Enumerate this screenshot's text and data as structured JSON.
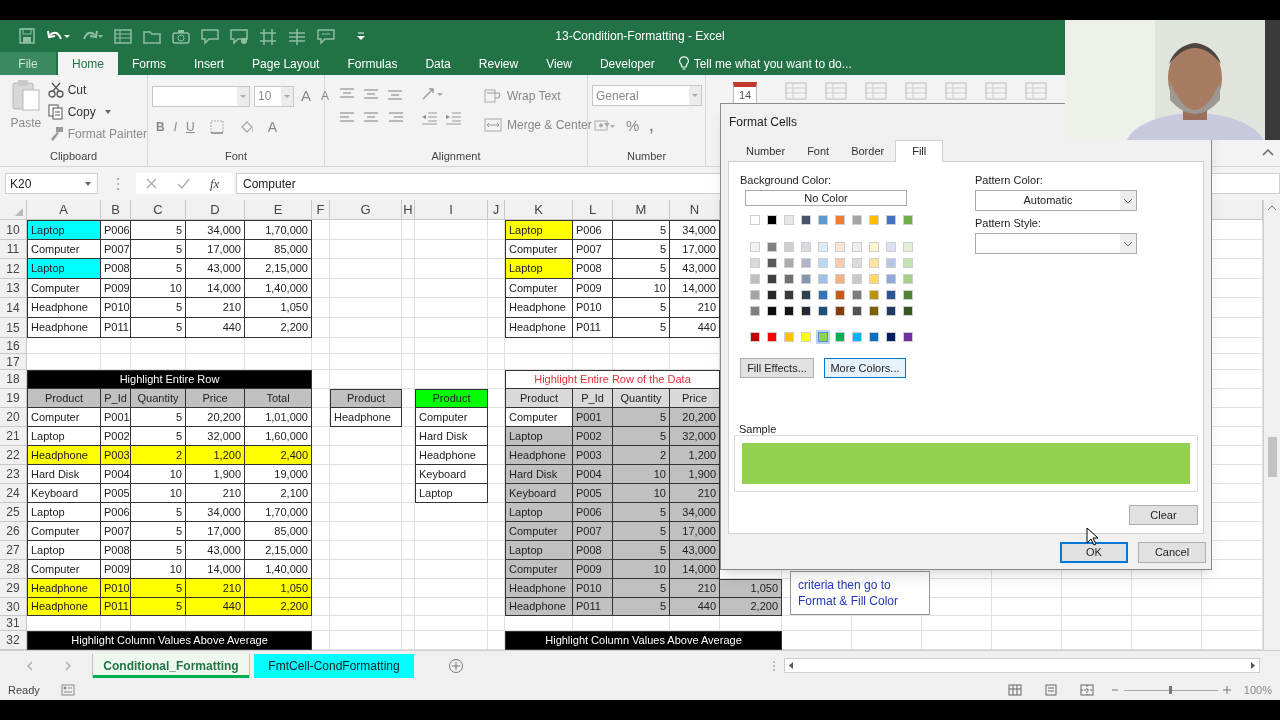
{
  "window": {
    "title": "13-Condition-Formatting - Excel"
  },
  "ribbon": {
    "tabs": [
      {
        "label": "File",
        "kind": "backstage",
        "selected": false
      },
      {
        "label": "Home",
        "kind": "tab",
        "selected": true
      },
      {
        "label": "Forms",
        "kind": "tab",
        "selected": false
      },
      {
        "label": "Insert",
        "kind": "tab",
        "selected": false
      },
      {
        "label": "Page Layout",
        "kind": "tab",
        "selected": false
      },
      {
        "label": "Formulas",
        "kind": "tab",
        "selected": false
      },
      {
        "label": "Data",
        "kind": "tab",
        "selected": false
      },
      {
        "label": "Review",
        "kind": "tab",
        "selected": false
      },
      {
        "label": "View",
        "kind": "tab",
        "selected": false
      },
      {
        "label": "Developer",
        "kind": "tab",
        "selected": false
      }
    ],
    "tell_me": "Tell me what you want to do...",
    "clipboard": {
      "paste": "Paste",
      "cut": "Cut",
      "copy": "Copy",
      "format_painter": "Format Painter",
      "label": "Clipboard"
    },
    "font": {
      "size": "10",
      "grow": "A",
      "shrink": "A",
      "bold": "B",
      "italic": "I",
      "underline": "U",
      "font_color": "A",
      "label": "Font"
    },
    "alignment": {
      "wrap_text": "Wrap Text",
      "merge_center": "Merge & Center",
      "label": "Alignment"
    },
    "number": {
      "format": "General",
      "percent": "%",
      "comma": ",",
      "label": "Number"
    },
    "calendar_day": "14"
  },
  "formula_bar": {
    "name_box": "K20",
    "fx": "fx",
    "formula": "Computer"
  },
  "grid": {
    "columns": [
      "A",
      "B",
      "C",
      "D",
      "E",
      "F",
      "G",
      "H",
      "I",
      "J",
      "K",
      "L",
      "M",
      "N"
    ],
    "rows": [
      {
        "number": "10",
        "cells": [
          {
            "text": "Laptop",
            "color": "#00ffff"
          },
          {
            "text": "P006"
          },
          {
            "text": "5"
          },
          {
            "text": "34,000"
          },
          {
            "text": "1,70,000"
          },
          {},
          {},
          {},
          {},
          {},
          {
            "text": "Laptop",
            "color": "#ffff00"
          },
          {
            "text": "P006"
          },
          {
            "text": "5"
          },
          {
            "text": "34,000"
          }
        ]
      },
      {
        "number": "11",
        "cells": [
          {
            "text": "Computer"
          },
          {
            "text": "P007"
          },
          {
            "text": "5"
          },
          {
            "text": "17,000"
          },
          {
            "text": "85,000"
          },
          {},
          {},
          {},
          {},
          {},
          {
            "text": "Computer"
          },
          {
            "text": "P007"
          },
          {
            "text": "5"
          },
          {
            "text": "17,000"
          }
        ]
      },
      {
        "number": "12",
        "cells": [
          {
            "text": "Laptop",
            "color": "#00ffff"
          },
          {
            "text": "P008"
          },
          {
            "text": "5"
          },
          {
            "text": "43,000"
          },
          {
            "text": "2,15,000"
          },
          {},
          {},
          {},
          {},
          {},
          {
            "text": "Laptop",
            "color": "#ffff00"
          },
          {
            "text": "P008"
          },
          {
            "text": "5"
          },
          {
            "text": "43,000"
          }
        ]
      },
      {
        "number": "13",
        "cells": [
          {
            "text": "Computer"
          },
          {
            "text": "P009"
          },
          {
            "text": "10"
          },
          {
            "text": "14,000"
          },
          {
            "text": "1,40,000"
          },
          {},
          {},
          {},
          {},
          {},
          {
            "text": "Computer"
          },
          {
            "text": "P009"
          },
          {
            "text": "10"
          },
          {
            "text": "14,000"
          }
        ]
      },
      {
        "number": "14",
        "cells": [
          {
            "text": "Headphone"
          },
          {
            "text": "P010"
          },
          {
            "text": "5"
          },
          {
            "text": "210"
          },
          {
            "text": "1,050"
          },
          {},
          {},
          {},
          {},
          {},
          {
            "text": "Headphone"
          },
          {
            "text": "P010"
          },
          {
            "text": "5"
          },
          {
            "text": "210"
          }
        ]
      },
      {
        "number": "15",
        "cells": [
          {
            "text": "Headphone"
          },
          {
            "text": "P011"
          },
          {
            "text": "5"
          },
          {
            "text": "440"
          },
          {
            "text": "2,200"
          },
          {},
          {},
          {},
          {},
          {},
          {
            "text": "Headphone"
          },
          {
            "text": "P011"
          },
          {
            "text": "5"
          },
          {
            "text": "440"
          }
        ]
      },
      {
        "number": "16",
        "cells": []
      },
      {
        "number": "17",
        "cells": []
      },
      {
        "number": "18",
        "cells": [
          {
            "kind": "banner",
            "text": "Highlight Entire Row"
          },
          {
            "kind": "merged"
          },
          {
            "kind": "merged"
          },
          {
            "kind": "merged"
          },
          {
            "kind": "merged"
          },
          {},
          {},
          {},
          {},
          {},
          {
            "kind": "title",
            "text": "Highlight Entire Row of the Data"
          },
          {
            "kind": "merged"
          },
          {
            "kind": "merged"
          },
          {
            "kind": "merged"
          }
        ]
      },
      {
        "number": "19",
        "cells": [
          {
            "kind": "header",
            "text": "Product",
            "color": "#c0c0c0"
          },
          {
            "kind": "header",
            "text": "P_Id",
            "color": "#c0c0c0"
          },
          {
            "kind": "header",
            "text": "Quantity",
            "color": "#c0c0c0"
          },
          {
            "kind": "header",
            "text": "Price",
            "color": "#c0c0c0"
          },
          {
            "kind": "header",
            "text": "Total",
            "color": "#c0c0c0"
          },
          {},
          {
            "kind": "header",
            "text": "Product",
            "color": "#c0c0c0"
          },
          {},
          {
            "kind": "header",
            "text": "Product",
            "color": "#00ff00"
          },
          {},
          {
            "kind": "header",
            "text": "Product",
            "color": "#d9d9d9"
          },
          {
            "kind": "header",
            "text": "P_Id",
            "color": "#d9d9d9"
          },
          {
            "kind": "header",
            "text": "Quantity",
            "color": "#d9d9d9"
          },
          {
            "kind": "header",
            "text": "Price",
            "color": "#d9d9d9"
          }
        ]
      },
      {
        "number": "20",
        "cells": [
          {
            "text": "Computer"
          },
          {
            "text": "P001"
          },
          {
            "text": "5"
          },
          {
            "text": "20,200"
          },
          {
            "text": "1,01,000"
          },
          {},
          {
            "text": "Headphone"
          },
          {},
          {
            "text": "Computer"
          },
          {},
          {
            "text": "Computer"
          },
          {
            "text": "P001",
            "color": "#c0c0c0"
          },
          {
            "text": "5",
            "color": "#c0c0c0"
          },
          {
            "text": "20,200",
            "color": "#c0c0c0"
          }
        ]
      },
      {
        "number": "21",
        "cells": [
          {
            "text": "Laptop"
          },
          {
            "text": "P002"
          },
          {
            "text": "5"
          },
          {
            "text": "32,000"
          },
          {
            "text": "1,60,000"
          },
          {},
          {},
          {},
          {
            "text": "Hard Disk"
          },
          {},
          {
            "text": "Laptop",
            "color": "#c0c0c0"
          },
          {
            "text": "P002",
            "color": "#c0c0c0"
          },
          {
            "text": "5",
            "color": "#c0c0c0"
          },
          {
            "text": "32,000",
            "color": "#c0c0c0"
          }
        ]
      },
      {
        "number": "22",
        "cells": [
          {
            "text": "Headphone",
            "color": "#ffff00"
          },
          {
            "text": "P003",
            "color": "#ffff00"
          },
          {
            "text": "2",
            "color": "#ffff00"
          },
          {
            "text": "1,200",
            "color": "#ffff00"
          },
          {
            "text": "2,400",
            "color": "#ffff00"
          },
          {},
          {},
          {},
          {
            "text": "Headphone"
          },
          {},
          {
            "text": "Headphone",
            "color": "#c0c0c0"
          },
          {
            "text": "P003",
            "color": "#c0c0c0"
          },
          {
            "text": "2",
            "color": "#c0c0c0"
          },
          {
            "text": "1,200",
            "color": "#c0c0c0"
          }
        ]
      },
      {
        "number": "23",
        "cells": [
          {
            "text": "Hard Disk"
          },
          {
            "text": "P004"
          },
          {
            "text": "10"
          },
          {
            "text": "1,900"
          },
          {
            "text": "19,000"
          },
          {},
          {},
          {},
          {
            "text": "Keyboard"
          },
          {},
          {
            "text": "Hard Disk",
            "color": "#c0c0c0"
          },
          {
            "text": "P004",
            "color": "#c0c0c0"
          },
          {
            "text": "10",
            "color": "#c0c0c0"
          },
          {
            "text": "1,900",
            "color": "#c0c0c0"
          }
        ]
      },
      {
        "number": "24",
        "cells": [
          {
            "text": "Keyboard"
          },
          {
            "text": "P005"
          },
          {
            "text": "10"
          },
          {
            "text": "210"
          },
          {
            "text": "2,100"
          },
          {},
          {},
          {},
          {
            "text": "Laptop"
          },
          {},
          {
            "text": "Keyboard",
            "color": "#c0c0c0"
          },
          {
            "text": "P005",
            "color": "#c0c0c0"
          },
          {
            "text": "10",
            "color": "#c0c0c0"
          },
          {
            "text": "210",
            "color": "#c0c0c0"
          }
        ]
      },
      {
        "number": "25",
        "cells": [
          {
            "text": "Laptop"
          },
          {
            "text": "P006"
          },
          {
            "text": "5"
          },
          {
            "text": "34,000"
          },
          {
            "text": "1,70,000"
          },
          {},
          {},
          {},
          {},
          {},
          {
            "text": "Laptop",
            "color": "#c0c0c0"
          },
          {
            "text": "P006",
            "color": "#c0c0c0"
          },
          {
            "text": "5",
            "color": "#c0c0c0"
          },
          {
            "text": "34,000",
            "color": "#c0c0c0"
          }
        ]
      },
      {
        "number": "26",
        "cells": [
          {
            "text": "Computer"
          },
          {
            "text": "P007"
          },
          {
            "text": "5"
          },
          {
            "text": "17,000"
          },
          {
            "text": "85,000"
          },
          {},
          {},
          {},
          {},
          {},
          {
            "text": "Computer",
            "color": "#c0c0c0"
          },
          {
            "text": "P007",
            "color": "#c0c0c0"
          },
          {
            "text": "5",
            "color": "#c0c0c0"
          },
          {
            "text": "17,000",
            "color": "#c0c0c0"
          }
        ]
      },
      {
        "number": "27",
        "cells": [
          {
            "text": "Laptop"
          },
          {
            "text": "P008"
          },
          {
            "text": "5"
          },
          {
            "text": "43,000"
          },
          {
            "text": "2,15,000"
          },
          {},
          {},
          {},
          {},
          {},
          {
            "text": "Laptop",
            "color": "#c0c0c0"
          },
          {
            "text": "P008",
            "color": "#c0c0c0"
          },
          {
            "text": "5",
            "color": "#c0c0c0"
          },
          {
            "text": "43,000",
            "color": "#c0c0c0"
          }
        ]
      },
      {
        "number": "28",
        "cells": [
          {
            "text": "Computer"
          },
          {
            "text": "P009"
          },
          {
            "text": "10"
          },
          {
            "text": "14,000"
          },
          {
            "text": "1,40,000"
          },
          {},
          {},
          {},
          {},
          {},
          {
            "text": "Computer",
            "color": "#c0c0c0"
          },
          {
            "text": "P009",
            "color": "#c0c0c0"
          },
          {
            "text": "10",
            "color": "#c0c0c0"
          },
          {
            "text": "14,000",
            "color": "#c0c0c0"
          }
        ]
      },
      {
        "number": "29",
        "cells": [
          {
            "text": "Headphone",
            "color": "#ffff00"
          },
          {
            "text": "P010",
            "color": "#ffff00"
          },
          {
            "text": "5",
            "color": "#ffff00"
          },
          {
            "text": "210",
            "color": "#ffff00"
          },
          {
            "text": "1,050",
            "color": "#ffff00"
          },
          {},
          {},
          {},
          {},
          {},
          {
            "text": "Headphone",
            "color": "#c0c0c0"
          },
          {
            "text": "P010",
            "color": "#c0c0c0"
          },
          {
            "text": "5",
            "color": "#c0c0c0"
          },
          {
            "text": "210",
            "color": "#c0c0c0"
          },
          {
            "text": "1,050",
            "color": "#c0c0c0"
          }
        ]
      },
      {
        "number": "30",
        "cells": [
          {
            "text": "Headphone",
            "color": "#ffff00"
          },
          {
            "text": "P011",
            "color": "#ffff00"
          },
          {
            "text": "5",
            "color": "#ffff00"
          },
          {
            "text": "440",
            "color": "#ffff00"
          },
          {
            "text": "2,200",
            "color": "#ffff00"
          },
          {},
          {},
          {},
          {},
          {},
          {
            "text": "Headphone",
            "color": "#c0c0c0"
          },
          {
            "text": "P011",
            "color": "#c0c0c0"
          },
          {
            "text": "5",
            "color": "#c0c0c0"
          },
          {
            "text": "440",
            "color": "#c0c0c0"
          },
          {
            "text": "2,200",
            "color": "#c0c0c0"
          }
        ]
      },
      {
        "number": "31",
        "cells": []
      },
      {
        "number": "32",
        "cells": [
          {
            "kind": "banner",
            "text": "Highlight Column Values Above Average"
          },
          {
            "kind": "merged"
          },
          {
            "kind": "merged"
          },
          {
            "kind": "merged"
          },
          {
            "kind": "merged"
          },
          {},
          {},
          {},
          {},
          {},
          {
            "kind": "banner",
            "text": "Highlight Column Values Above Average"
          },
          {
            "kind": "merged"
          },
          {
            "kind": "merged"
          },
          {
            "kind": "merged"
          },
          {
            "kind": "merged"
          }
        ]
      }
    ],
    "note": {
      "lines": [
        "criteria then go to",
        "Format & Fill Color"
      ]
    }
  },
  "dialog": {
    "title": "Format Cells",
    "tabs": [
      {
        "label": "Number",
        "selected": false
      },
      {
        "label": "Font",
        "selected": false
      },
      {
        "label": "Border",
        "selected": false
      },
      {
        "label": "Fill",
        "selected": true
      }
    ],
    "background_color_label": "Background Color:",
    "no_color_button": "No Color",
    "theme_colors": [
      {
        "color": "#ffffff",
        "selected": false
      },
      {
        "color": "#000000",
        "selected": false
      },
      {
        "color": "#e7e6e6",
        "selected": false
      },
      {
        "color": "#44546a",
        "selected": false
      },
      {
        "color": "#5b9bd5",
        "selected": false
      },
      {
        "color": "#ed7d31",
        "selected": false
      },
      {
        "color": "#a5a5a5",
        "selected": false
      },
      {
        "color": "#ffc000",
        "selected": false
      },
      {
        "color": "#4472c4",
        "selected": false
      },
      {
        "color": "#70ad47",
        "selected": false
      }
    ],
    "tint_rows": [
      [
        {
          "color": "#f2f2f2",
          "selected": false
        },
        {
          "color": "#7f7f7f",
          "selected": false
        },
        {
          "color": "#d0cece",
          "selected": false
        },
        {
          "color": "#d6dce4",
          "selected": false
        },
        {
          "color": "#deebf6",
          "selected": false
        },
        {
          "color": "#fbe5d5",
          "selected": false
        },
        {
          "color": "#ededed",
          "selected": false
        },
        {
          "color": "#fff2cc",
          "selected": false
        },
        {
          "color": "#d9e2f3",
          "selected": false
        },
        {
          "color": "#e2efd9",
          "selected": false
        }
      ],
      [
        {
          "color": "#d8d8d8",
          "selected": false
        },
        {
          "color": "#595959",
          "selected": false
        },
        {
          "color": "#aeabab",
          "selected": false
        },
        {
          "color": "#adb9ca",
          "selected": false
        },
        {
          "color": "#bdd7ee",
          "selected": false
        },
        {
          "color": "#f7cbac",
          "selected": false
        },
        {
          "color": "#dbdbdb",
          "selected": false
        },
        {
          "color": "#fee599",
          "selected": false
        },
        {
          "color": "#b4c6e7",
          "selected": false
        },
        {
          "color": "#c5e0b3",
          "selected": false
        }
      ],
      [
        {
          "color": "#bfbfbf",
          "selected": false
        },
        {
          "color": "#3f3f3f",
          "selected": false
        },
        {
          "color": "#757070",
          "selected": false
        },
        {
          "color": "#8496b0",
          "selected": false
        },
        {
          "color": "#9dc3e6",
          "selected": false
        },
        {
          "color": "#f4b183",
          "selected": false
        },
        {
          "color": "#c9c9c9",
          "selected": false
        },
        {
          "color": "#ffd965",
          "selected": false
        },
        {
          "color": "#8eaadb",
          "selected": false
        },
        {
          "color": "#a8d08d",
          "selected": false
        }
      ],
      [
        {
          "color": "#a5a5a5",
          "selected": false
        },
        {
          "color": "#262626",
          "selected": false
        },
        {
          "color": "#3a3838",
          "selected": false
        },
        {
          "color": "#323f4f",
          "selected": false
        },
        {
          "color": "#2e75b5",
          "selected": false
        },
        {
          "color": "#c55a11",
          "selected": false
        },
        {
          "color": "#7b7b7b",
          "selected": false
        },
        {
          "color": "#bf9000",
          "selected": false
        },
        {
          "color": "#2f5496",
          "selected": false
        },
        {
          "color": "#538135",
          "selected": false
        }
      ],
      [
        {
          "color": "#7f7f7f",
          "selected": false
        },
        {
          "color": "#0c0c0c",
          "selected": false
        },
        {
          "color": "#171616",
          "selected": false
        },
        {
          "color": "#222a35",
          "selected": false
        },
        {
          "color": "#1e4e79",
          "selected": false
        },
        {
          "color": "#833c0b",
          "selected": false
        },
        {
          "color": "#525252",
          "selected": false
        },
        {
          "color": "#7f6000",
          "selected": false
        },
        {
          "color": "#1f3864",
          "selected": false
        },
        {
          "color": "#375623",
          "selected": false
        }
      ]
    ],
    "standard_colors": [
      {
        "color": "#c00000",
        "selected": false
      },
      {
        "color": "#ff0000",
        "selected": false
      },
      {
        "color": "#ffc000",
        "selected": false
      },
      {
        "color": "#ffff00",
        "selected": false
      },
      {
        "color": "#92d050",
        "selected": true
      },
      {
        "color": "#00b050",
        "selected": false
      },
      {
        "color": "#00b0f0",
        "selected": false
      },
      {
        "color": "#0070c0",
        "selected": false
      },
      {
        "color": "#002060",
        "selected": false
      },
      {
        "color": "#7030a0",
        "selected": false
      }
    ],
    "fill_effects_button": "Fill Effects...",
    "more_colors_button": "More Colors...",
    "pattern_color_label": "Pattern Color:",
    "pattern_color_value": "Automatic",
    "pattern_style_label": "Pattern Style:",
    "sample_label": "Sample",
    "sample": {
      "color": "#92d050"
    },
    "clear_button": "Clear",
    "ok_button": "OK",
    "cancel_button": "Cancel"
  },
  "sheet_tabs": [
    {
      "label": "Conditional_Formatting",
      "selected": true,
      "color": "#00b050"
    },
    {
      "label": "FmtCell-CondFormatting",
      "selected": false,
      "color": "#00ffff"
    }
  ],
  "status_bar": {
    "status": "Ready",
    "zoom_slider": {
      "level": 0.5
    },
    "zoom": "100%"
  }
}
